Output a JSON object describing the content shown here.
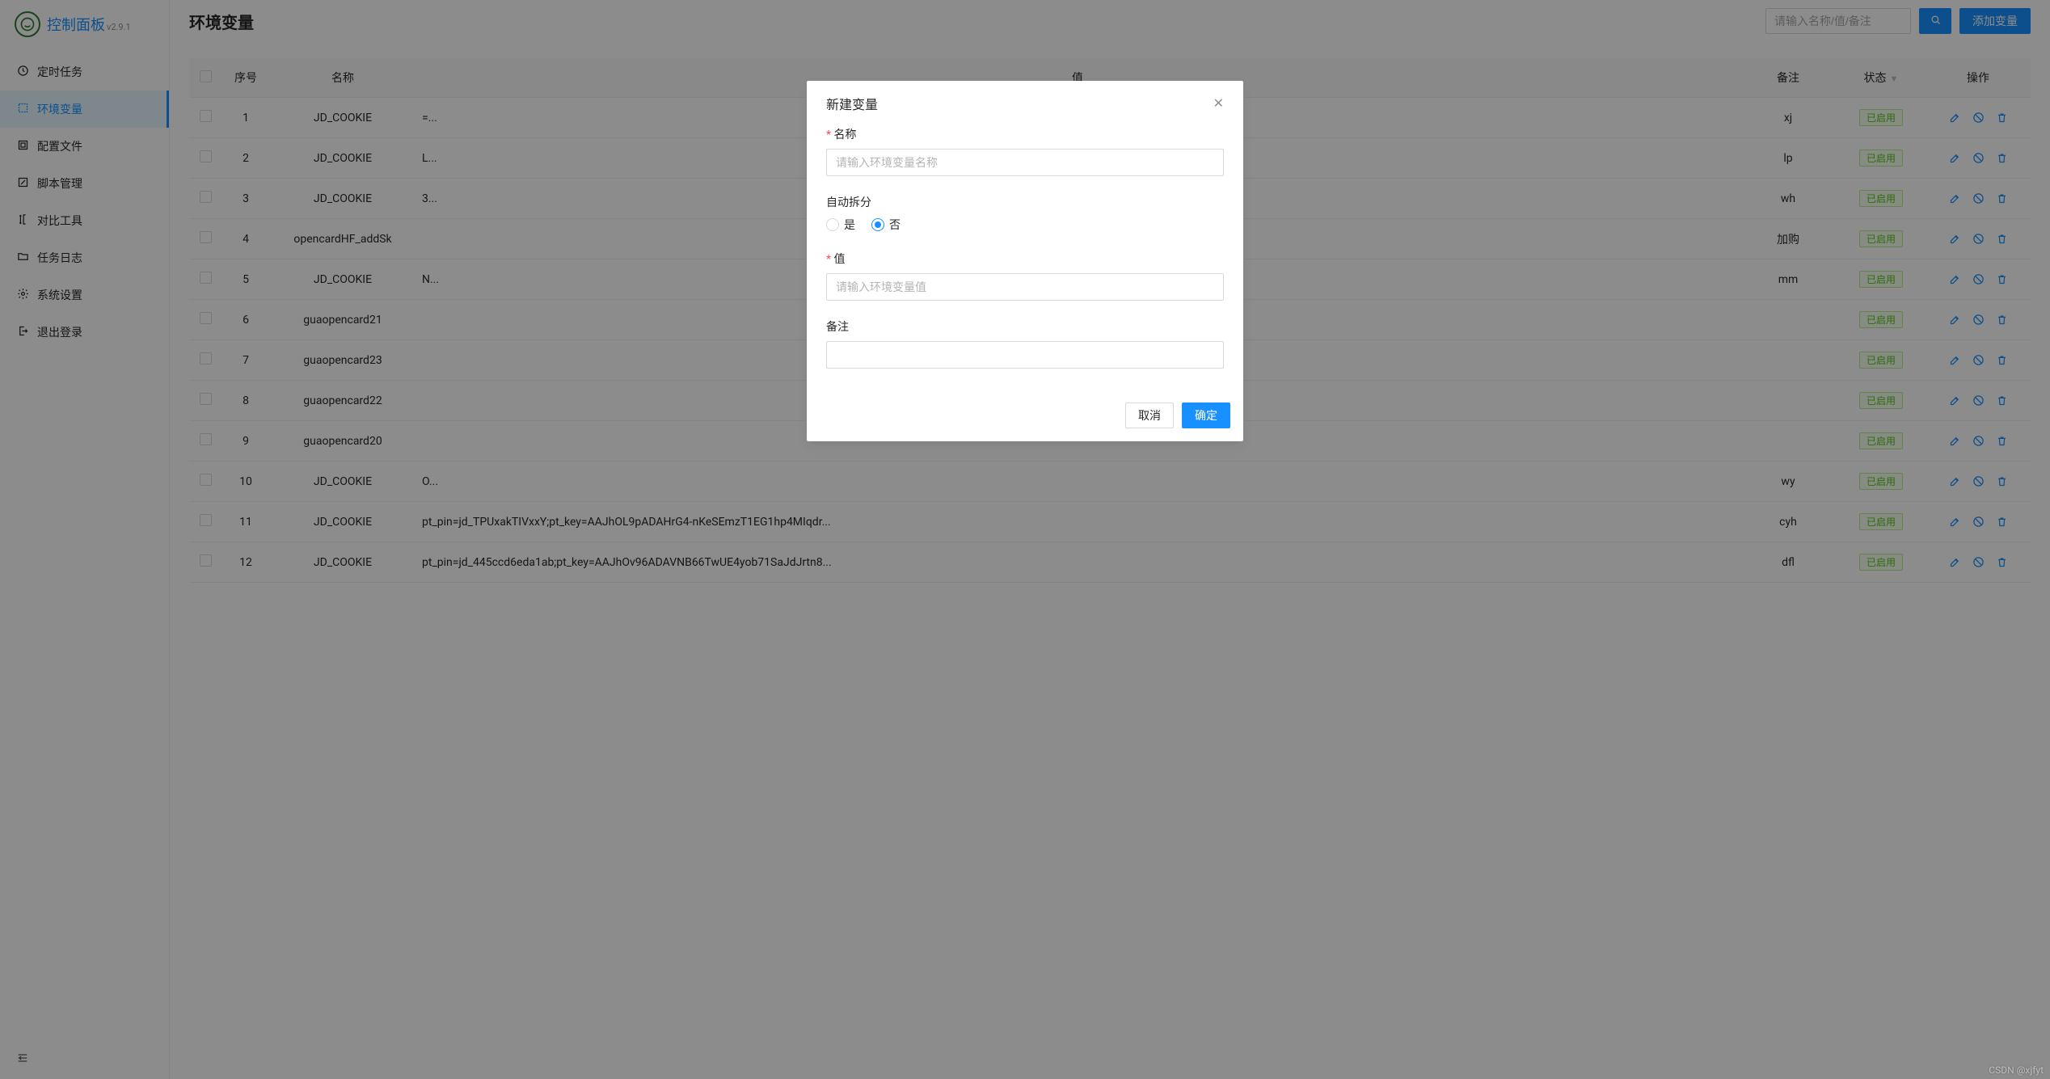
{
  "brand": {
    "title": "控制面板",
    "version": "v2.9.1"
  },
  "sidebar": {
    "items": [
      {
        "label": "定时任务"
      },
      {
        "label": "环境变量"
      },
      {
        "label": "配置文件"
      },
      {
        "label": "脚本管理"
      },
      {
        "label": "对比工具"
      },
      {
        "label": "任务日志"
      },
      {
        "label": "系统设置"
      },
      {
        "label": "退出登录"
      }
    ]
  },
  "header": {
    "title": "环境变量",
    "search_placeholder": "请输入名称/值/备注",
    "add_button": "添加变量"
  },
  "table": {
    "columns": {
      "index": "序号",
      "name": "名称",
      "value": "值",
      "remark": "备注",
      "status": "状态",
      "ops": "操作"
    },
    "status_enabled": "已启用",
    "rows": [
      {
        "idx": "1",
        "name": "JD_COOKIE",
        "value": "=...",
        "remark": "xj",
        "status": "已启用"
      },
      {
        "idx": "2",
        "name": "JD_COOKIE",
        "value": "L...",
        "remark": "lp",
        "status": "已启用"
      },
      {
        "idx": "3",
        "name": "JD_COOKIE",
        "value": "3...",
        "remark": "wh",
        "status": "已启用"
      },
      {
        "idx": "4",
        "name": "opencardHF_addSk",
        "value": "",
        "remark": "加购",
        "status": "已启用"
      },
      {
        "idx": "5",
        "name": "JD_COOKIE",
        "value": "N...",
        "remark": "mm",
        "status": "已启用"
      },
      {
        "idx": "6",
        "name": "guaopencard21",
        "value": "",
        "remark": "",
        "status": "已启用"
      },
      {
        "idx": "7",
        "name": "guaopencard23",
        "value": "",
        "remark": "",
        "status": "已启用"
      },
      {
        "idx": "8",
        "name": "guaopencard22",
        "value": "",
        "remark": "",
        "status": "已启用"
      },
      {
        "idx": "9",
        "name": "guaopencard20",
        "value": "",
        "remark": "",
        "status": "已启用"
      },
      {
        "idx": "10",
        "name": "JD_COOKIE",
        "value": "O...",
        "remark": "wy",
        "status": "已启用"
      },
      {
        "idx": "11",
        "name": "JD_COOKIE",
        "value": "pt_pin=jd_TPUxakTIVxxY;pt_key=AAJhOL9pADAHrG4-nKeSEmzT1EG1hp4MIqdr...",
        "remark": "cyh",
        "status": "已启用"
      },
      {
        "idx": "12",
        "name": "JD_COOKIE",
        "value": "pt_pin=jd_445ccd6eda1ab;pt_key=AAJhOv96ADAVNB66TwUE4yob71SaJdJrtn8...",
        "remark": "dfl",
        "status": "已启用"
      }
    ]
  },
  "modal": {
    "title": "新建变量",
    "name_label": "名称",
    "name_placeholder": "请输入环境变量名称",
    "split_label": "自动拆分",
    "split_yes": "是",
    "split_no": "否",
    "value_label": "值",
    "value_placeholder": "请输入环境变量值",
    "remark_label": "备注",
    "cancel": "取消",
    "ok": "确定"
  },
  "watermark": "CSDN @xjfyt"
}
